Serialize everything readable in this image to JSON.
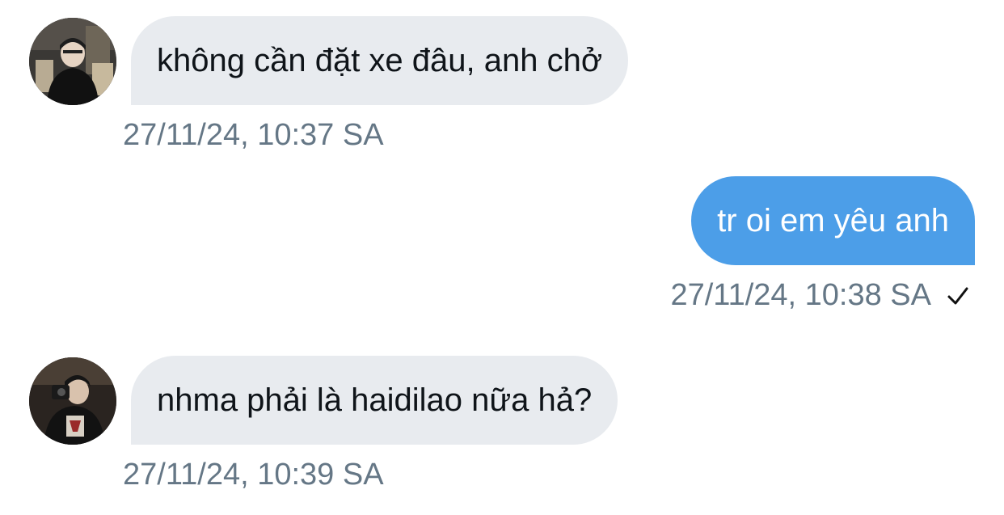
{
  "messages": [
    {
      "direction": "incoming",
      "text": "không cần đặt xe đâu, anh chở",
      "timestamp": "27/11/24, 10:37 SA",
      "avatar": "user-avatar-1"
    },
    {
      "direction": "outgoing",
      "text": "tr oi em yêu anh",
      "timestamp": "27/11/24, 10:38 SA",
      "status_icon": "checkmark-icon"
    },
    {
      "direction": "incoming",
      "text": "nhma phải là haidilao nữa hả?",
      "timestamp": "27/11/24, 10:39 SA",
      "avatar": "user-avatar-2"
    }
  ],
  "colors": {
    "incoming_bubble": "#e8ebef",
    "outgoing_bubble": "#4c9ee8",
    "timestamp": "#657786"
  }
}
